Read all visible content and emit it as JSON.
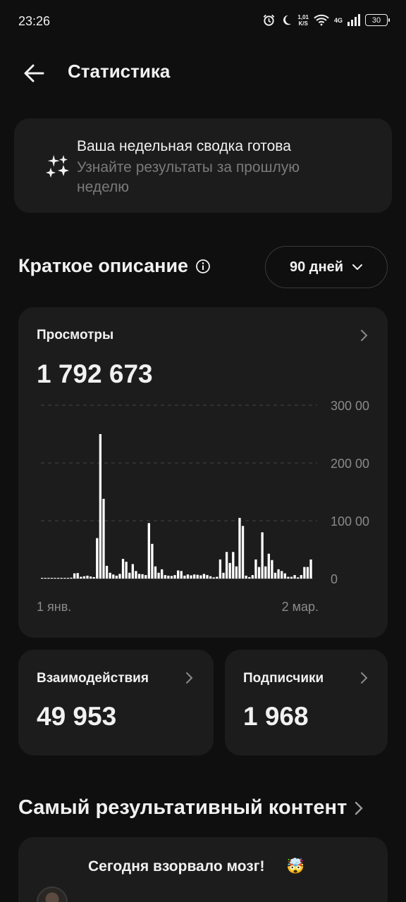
{
  "status_bar": {
    "time": "23:26",
    "net_speed_value": "1,01",
    "net_speed_unit": "K/S",
    "network_gen": "4G",
    "battery": "30"
  },
  "header": {
    "title": "Статистика"
  },
  "weekly_summary": {
    "title": "Ваша недельная сводка готова",
    "subtitle": "Узнайте результаты за прошлую неделю"
  },
  "overview": {
    "title": "Краткое описание",
    "range_label": "90 дней"
  },
  "views": {
    "label": "Просмотры",
    "value": "1 792 673"
  },
  "interactions": {
    "label": "Взаимодействия",
    "value": "49 953"
  },
  "subscribers": {
    "label": "Подписчики",
    "value": "1 968"
  },
  "top_content": {
    "title": "Самый результативный контент",
    "post_text": "Сегодня взорвало мозг!",
    "post_emoji": "🤯"
  },
  "colors": {
    "background": "#0f0f0f",
    "card": "#1c1c1c",
    "text": "#f1f1f1",
    "muted": "#7a7a7a",
    "bar": "#ffffff",
    "grid": "#444444"
  },
  "chart_data": {
    "type": "bar",
    "title": "",
    "xlabel": "",
    "ylabel": "",
    "ylim": [
      0,
      300000
    ],
    "y_tick_labels": [
      "0",
      "100 00",
      "200 00",
      "300 00"
    ],
    "x_tick_labels": [
      "1 янв.",
      "2 мар."
    ],
    "grid": true,
    "values": [
      200,
      300,
      400,
      300,
      200,
      300,
      500,
      800,
      1200,
      1500,
      9000,
      9500,
      3000,
      4000,
      5000,
      3500,
      2500,
      70000,
      250000,
      138000,
      22000,
      10000,
      7000,
      5000,
      8000,
      34000,
      29000,
      10000,
      25000,
      13000,
      8000,
      7500,
      6000,
      96000,
      60000,
      21000,
      10000,
      16000,
      6000,
      5000,
      4500,
      6000,
      14000,
      13000,
      5000,
      7000,
      5500,
      7000,
      6500,
      5500,
      8000,
      6000,
      4000,
      2000,
      3000,
      33000,
      10000,
      46000,
      27000,
      46000,
      21000,
      105000,
      91000,
      5000,
      2500,
      6000,
      33000,
      20000,
      80000,
      21000,
      43000,
      32000,
      10000,
      16000,
      13000,
      9000,
      3000,
      3000,
      6000,
      2000,
      6000,
      20000,
      20000,
      33000
    ]
  }
}
